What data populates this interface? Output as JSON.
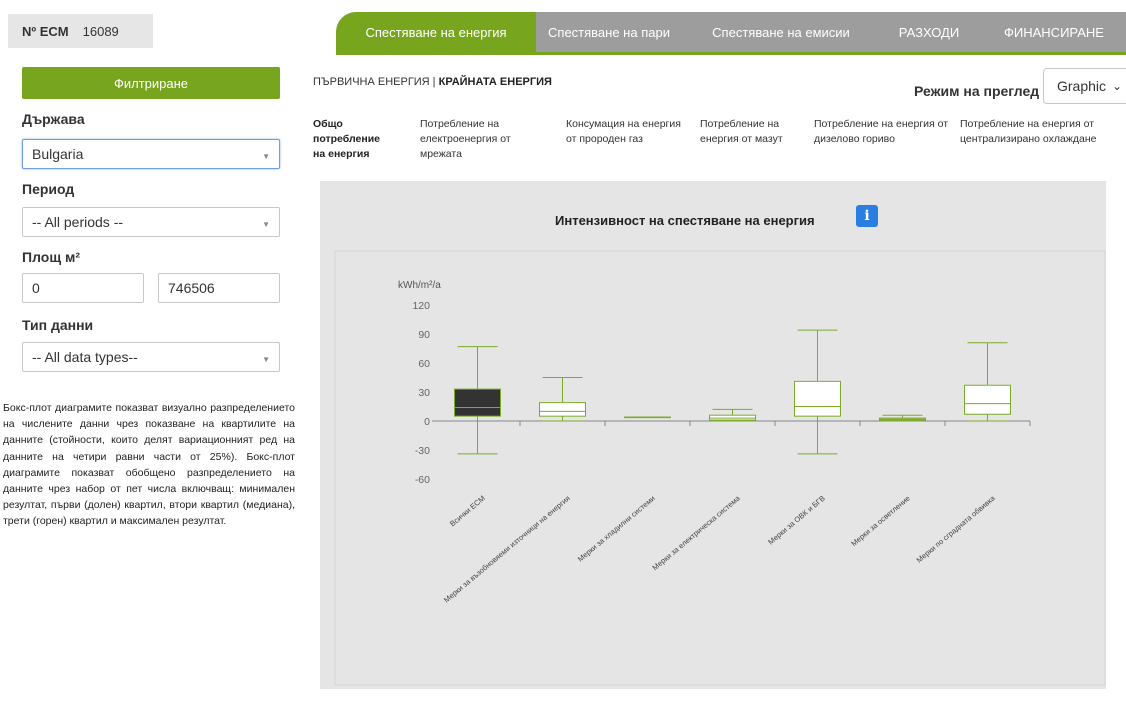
{
  "ecm": {
    "label": "Nº ECM",
    "value": "16089"
  },
  "nav_tabs": [
    {
      "label": "Спестяване на енергия",
      "active": true
    },
    {
      "label": "Спестяване на пари",
      "active": false
    },
    {
      "label": "Спестяване на емисии",
      "active": false
    },
    {
      "label": "РАЗХОДИ",
      "active": false
    },
    {
      "label": "ФИНАНСИРАНЕ",
      "active": false
    }
  ],
  "sidebar": {
    "filter_label": "Филтриране",
    "country_label": "Държава",
    "country_value": "Bulgaria",
    "period_label": "Период",
    "period_value": "-- All periods --",
    "area_label": "Площ м²",
    "area_min": "0",
    "area_max": "746506",
    "datatype_label": "Тип данни",
    "datatype_value": "-- All data types--",
    "description": "Бокс-плот диаграмите показват визуално разпределението на числените данни чрез показване на квартилите на данните (стойности, които делят вариационният ред на данните на четири равни части от 25%). Бокс-плот диаграмите показват обобщено разпределението на данните чрез набор от пет числа включващ: минимален резултат, първи (долен) квартил, втори квартил (медиана), трети (горен) квартил и максимален резултат."
  },
  "energy_tabs": {
    "primary": "ПЪРВИЧНА ЕНЕРГИЯ",
    "separator": " | ",
    "final": "КРАЙНАТА ЕНЕРГИЯ"
  },
  "view_mode": {
    "label": "Режим на преглед",
    "value": "Graphic"
  },
  "metrics": [
    {
      "label": "Общо потребление на енергия",
      "active": true
    },
    {
      "label": "Потребление на електроенергия от мрежата",
      "active": false
    },
    {
      "label": "Консумация на енергия от пророден газ",
      "active": false
    },
    {
      "label": "Потребление на енергия от мазут",
      "active": false
    },
    {
      "label": "Потребление на енергия от дизелово гориво",
      "active": false
    },
    {
      "label": "Потребление на енергия от централизирано охлаждане",
      "active": false
    }
  ],
  "chart_title": "Интензивност на спестяване на енергия",
  "info_label": "i",
  "colors": {
    "accent": "#78a51e",
    "tab_inactive": "#9d9d9d",
    "info": "#2a7de1",
    "box_dark": "#333333",
    "panel": "#e5e5e5"
  },
  "chart_data": {
    "type": "boxplot",
    "title": "Интензивност на спестяване на енергия",
    "ylabel": "kWh/m²/a",
    "ylim": [
      -60,
      120
    ],
    "yticks": [
      -60,
      -30,
      0,
      30,
      60,
      90,
      120
    ],
    "categories": [
      "Всички ECM",
      "Мерки за възобновяеми източници на енергия",
      "Мерки за хладилни системи",
      "Мерки за електрическа система",
      "Мерки за ОВК и БГВ",
      "Мерки за осветление",
      "Мерки по сградната обвивка"
    ],
    "series": [
      {
        "min": -34,
        "q1": 5,
        "median": 14,
        "q3": 33,
        "max": 77
      },
      {
        "min": 0,
        "q1": 5,
        "median": 10,
        "q3": 19,
        "max": 45
      },
      {
        "min": 4,
        "q1": 4,
        "median": 4,
        "q3": 4,
        "max": 4
      },
      {
        "min": 0,
        "q1": 1,
        "median": 3,
        "q3": 6,
        "max": 12
      },
      {
        "min": -34,
        "q1": 5,
        "median": 15,
        "q3": 41,
        "max": 94
      },
      {
        "min": 0,
        "q1": 1,
        "median": 2,
        "q3": 3,
        "max": 6
      },
      {
        "min": 0,
        "q1": 7,
        "median": 18,
        "q3": 37,
        "max": 81
      }
    ],
    "grid": false
  }
}
